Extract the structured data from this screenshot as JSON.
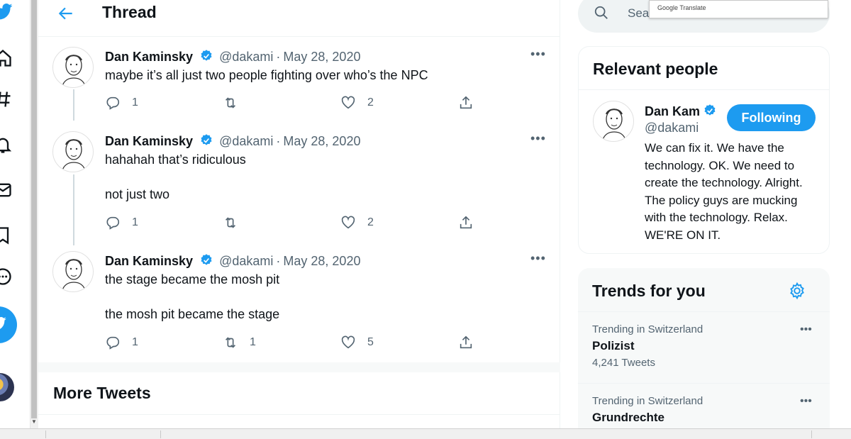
{
  "header": {
    "title": "Thread"
  },
  "tweets": [
    {
      "name": "Dan Kaminsky",
      "handle": "@dakami",
      "separator": "·",
      "date": "May 28, 2020",
      "lines": [
        "maybe it’s all just two people fighting over who’s the NPC"
      ],
      "replies": "1",
      "retweets": "",
      "likes": "2"
    },
    {
      "name": "Dan Kaminsky",
      "handle": "@dakami",
      "separator": "·",
      "date": "May 28, 2020",
      "lines": [
        "hahahah that’s ridiculous",
        "not just two"
      ],
      "replies": "1",
      "retweets": "",
      "likes": "2"
    },
    {
      "name": "Dan Kaminsky",
      "handle": "@dakami",
      "separator": "·",
      "date": "May 28, 2020",
      "lines": [
        "the stage became the mosh pit",
        "the mosh pit became the stage"
      ],
      "replies": "1",
      "retweets": "1",
      "likes": "5"
    }
  ],
  "more_tweets": {
    "title": "More Tweets"
  },
  "search": {
    "placeholder": "Sea"
  },
  "translate_popup": {
    "label": "Google Translate"
  },
  "relevant_people": {
    "title": "Relevant people",
    "name": "Dan Kam",
    "handle": "@dakami",
    "follow_label": "Following",
    "bio": "We can fix it. We have the technology. OK. We need to create the technology. Alright. The policy guys are mucking with the technology. Relax. WE'RE ON IT."
  },
  "trends": {
    "title": "Trends for you",
    "items": [
      {
        "meta": "Trending in Switzerland",
        "name": "Polizist",
        "count": "4,241 Tweets"
      },
      {
        "meta": "Trending in Switzerland",
        "name": "Grundrechte",
        "count": ""
      }
    ]
  },
  "colors": {
    "accent": "#1d9bf0",
    "muted": "#536471",
    "text": "#0f1419"
  },
  "icons": [
    "twitter-icon",
    "home-icon",
    "explore-icon",
    "notifications-icon",
    "messages-icon",
    "bookmarks-icon",
    "more-icon",
    "back-arrow-icon",
    "verified-icon",
    "reply-icon",
    "retweet-icon",
    "like-icon",
    "share-icon",
    "more-dots-icon",
    "search-icon",
    "settings-gear-icon"
  ]
}
